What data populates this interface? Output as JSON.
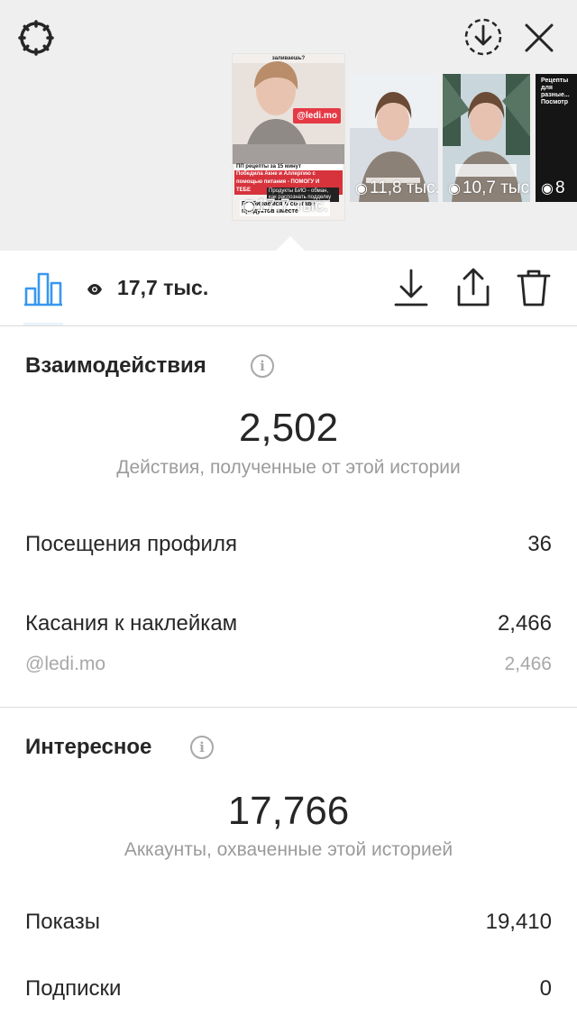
{
  "thumbnails": [
    {
      "top_text": "заливаешь?",
      "handle": "@ledi.mo",
      "caption_lines": [
        "ПП рецепты за 15 минут"
      ],
      "caption_red_lines": [
        "Победила Акне и Аллергию с",
        "помощью питания - ПОМОГУ И",
        "ТЕБЕ"
      ],
      "caption_dark": "Продукты БИО - обман, как распознать подделку",
      "caption_bottom": "Разбираемся в составе продуктов вместе",
      "views": "17,7 тыс."
    },
    {
      "views": "11,8 тыс."
    },
    {
      "views": "10,7 тыс."
    },
    {
      "views": "8",
      "top_text": "Рецепты для разные... Посмотр"
    }
  ],
  "toolbar": {
    "views": "17,7 тыс."
  },
  "interactions": {
    "title": "Взаимодействия",
    "total": "2,502",
    "caption": "Действия, полученные от этой истории",
    "rows": [
      {
        "label": "Посещения профиля",
        "value": "36"
      },
      {
        "label": "Касания к наклейкам",
        "value": "2,466"
      }
    ],
    "sub_rows": [
      {
        "label": "@ledi.mo",
        "value": "2,466"
      }
    ]
  },
  "discovery": {
    "title": "Интересное",
    "total": "17,766",
    "caption": "Аккаунты, охваченные этой историей",
    "rows": [
      {
        "label": "Показы",
        "value": "19,410"
      },
      {
        "label": "Подписки",
        "value": "0"
      }
    ]
  },
  "icons": {
    "settings": "gear-icon",
    "download_circle": "download-circle-icon",
    "close": "close-icon",
    "insights": "bar-chart-icon",
    "views": "eye-icon",
    "save": "download-icon",
    "share": "share-icon",
    "delete": "trash-icon",
    "info": "info-icon"
  },
  "colors": {
    "accent": "#3897f0",
    "text": "#262626",
    "muted": "#9b9b9b",
    "divider": "#dbdbdb",
    "top_background": "#efefef",
    "sticker_red": "#e53945"
  }
}
